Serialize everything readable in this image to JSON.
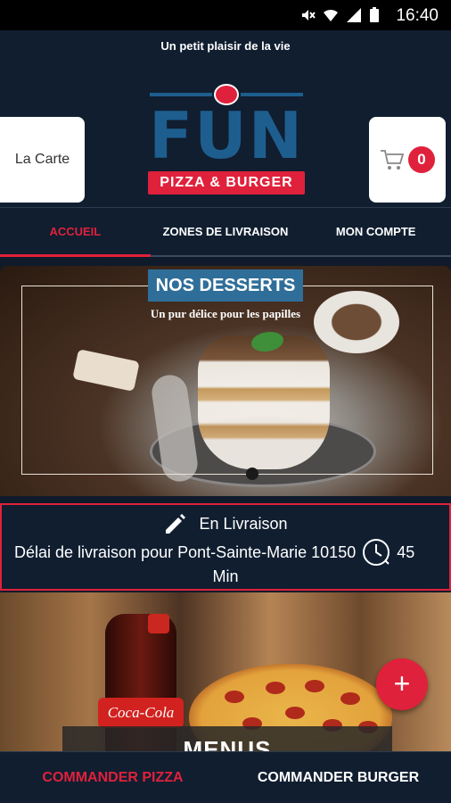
{
  "status_bar": {
    "time": "16:40",
    "icons": [
      "mute-icon",
      "wifi-icon",
      "signal-icon",
      "battery-icon"
    ]
  },
  "header": {
    "tagline": "Un petit plaisir de la vie",
    "menu_button": "La Carte",
    "cart_count": "0",
    "logo": {
      "main": "FUN",
      "sub": "PIZZA & BURGER"
    }
  },
  "tabs": [
    {
      "label": "ACCUEIL",
      "active": true
    },
    {
      "label": "ZONES DE LIVRAISON",
      "active": false
    },
    {
      "label": "MON COMPTE",
      "active": false
    }
  ],
  "slider": {
    "title": "NOS DESSERTS",
    "subtitle": "Un pur délice pour les papilles"
  },
  "delivery": {
    "mode": "En Livraison",
    "text": "Délai de livraison pour Pont-Sainte-Marie 10150",
    "time": "45",
    "unit": "Min"
  },
  "promo": {
    "label": "MENUS",
    "bottle_brand": "Coca-Cola"
  },
  "bottom_bar": [
    {
      "label": "COMMANDER PIZZA",
      "active": true
    },
    {
      "label": "COMMANDER BURGER",
      "active": false
    }
  ],
  "colors": {
    "accent": "#e0213b",
    "navy": "#101e30",
    "blue": "#2f6e98"
  }
}
